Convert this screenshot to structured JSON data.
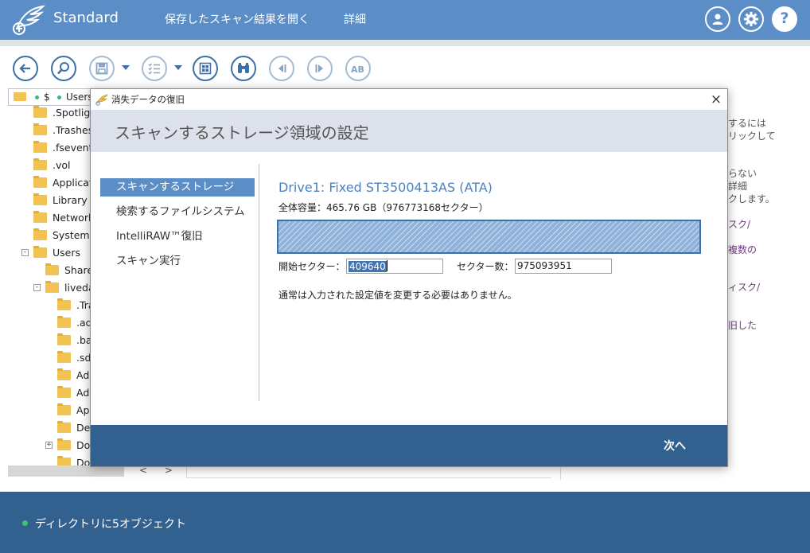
{
  "header": {
    "app_title": "Standard",
    "menu": [
      {
        "label": "保存したスキャン結果を開く"
      },
      {
        "label": "詳細"
      }
    ],
    "icons": [
      "user-icon",
      "gear-icon",
      "help-icon"
    ]
  },
  "toolbar": {
    "buttons": [
      "back-icon",
      "search-icon",
      "save-icon",
      "checklist-icon",
      "grid-view-icon",
      "binoculars-icon",
      "previous-icon",
      "next-icon",
      "text-icon"
    ]
  },
  "path": {
    "segments": [
      "$",
      "Users"
    ]
  },
  "tree": {
    "items": [
      {
        "label": ".Spotlight"
      },
      {
        "label": ".Trashes"
      },
      {
        "label": ".fseventsd"
      },
      {
        "label": ".vol"
      },
      {
        "label": "Applications"
      },
      {
        "label": "Library"
      },
      {
        "label": "Network"
      },
      {
        "label": "System"
      },
      {
        "label": "Users",
        "expander": "-"
      },
      {
        "label": "Shared"
      },
      {
        "label": "livedata",
        "expander": "-"
      },
      {
        "label": ".Trash"
      },
      {
        "label": ".adobe"
      },
      {
        "label": ".bash"
      },
      {
        "label": ".sdk"
      },
      {
        "label": "Adobe"
      },
      {
        "label": "Adobe"
      },
      {
        "label": "Apps"
      },
      {
        "label": "Desktop"
      },
      {
        "label": "Documents",
        "expander": "+"
      },
      {
        "label": "Downloads"
      }
    ],
    "scroll_left": "<",
    "scroll_right": ">"
  },
  "info_panel": {
    "lines": [
      "するには",
      "リックして",
      "らない",
      "詳細",
      "クします。",
      "スク/",
      "複数の",
      "ィスク/",
      "旧した"
    ]
  },
  "status": {
    "text": "ディレクトリに5オブジェクト",
    "dot_color": "#3ec46d"
  },
  "dialog": {
    "window_title": "消失データの復旧",
    "close_label": "×",
    "heading": "スキャンするストレージ領域の設定",
    "steps": [
      {
        "label": "スキャンするストレージ"
      },
      {
        "label": "検索するファイルシステム"
      },
      {
        "label": "IntelliRAW™復旧"
      },
      {
        "label": "スキャン実行"
      }
    ],
    "drive_title": "Drive1: Fixed ST3500413AS (ATA)",
    "capacity": "全体容量：465.76 GB（976773168セクター）",
    "start_sector_label": "開始セクター：",
    "start_sector_value": "409640",
    "sector_count_label": "セクター数：",
    "sector_count_value": "975093951",
    "note": "通常は入力された設定値を変更する必要はありません。",
    "next_label": "次へ",
    "accent_color": "#5b8ec6",
    "footer_color": "#33618f"
  }
}
